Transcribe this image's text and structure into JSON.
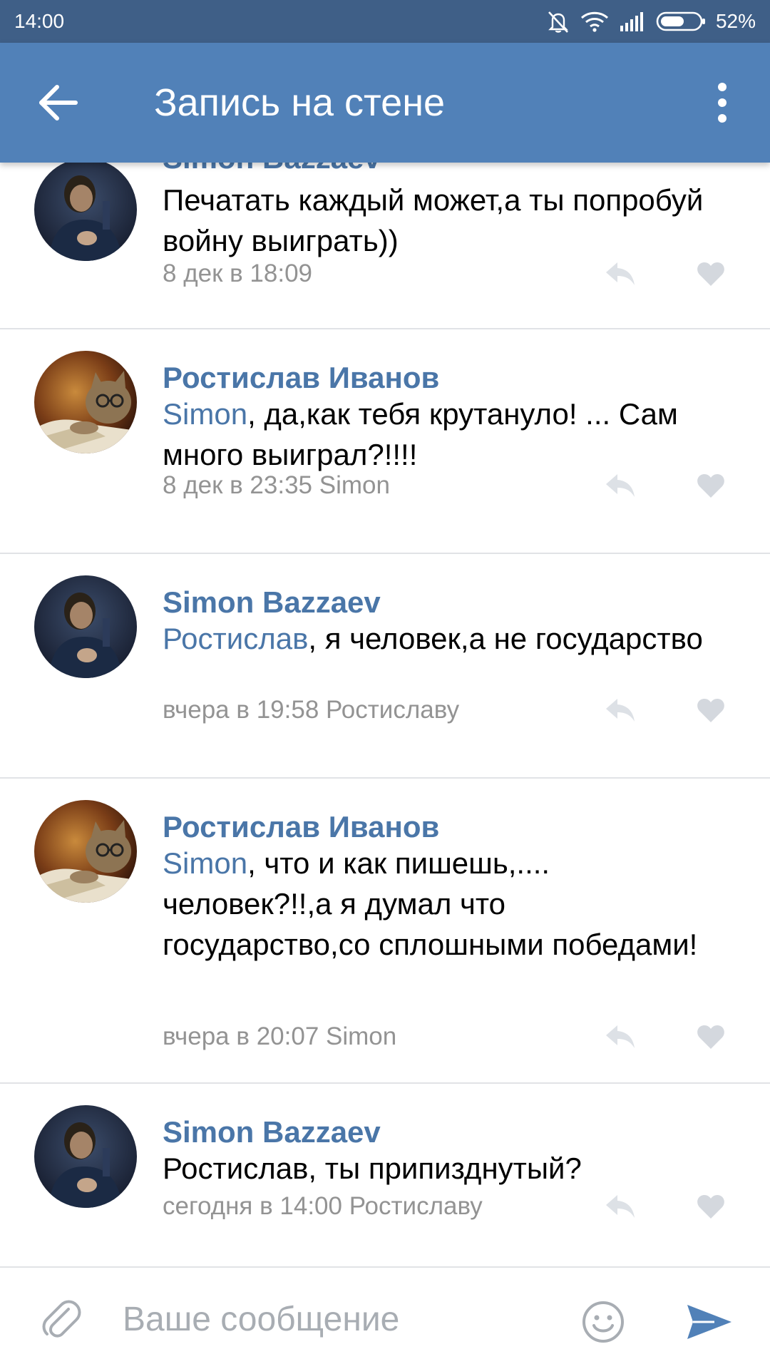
{
  "status_bar": {
    "time": "14:00",
    "battery_percent": "52%",
    "icons": [
      "muted-bell-icon",
      "wifi-icon",
      "signal-icon",
      "battery-icon"
    ]
  },
  "app_bar": {
    "title": "Запись на стене",
    "back_icon": "arrow-left-icon",
    "menu_icon": "more-vertical-icon"
  },
  "colors": {
    "status_bar": "#3f5f87",
    "app_bar": "#5181b8",
    "link": "#4a76a8",
    "meta": "#939393",
    "divider": "#e1e3e6"
  },
  "comments": [
    {
      "author": "Simon Bazzaev",
      "mention": "",
      "text": "Печатать каждый может,а ты попробуй войну выиграть))",
      "meta": "8 дек в 18:09"
    },
    {
      "author": "Ростислав Иванов",
      "mention": "Simon",
      "text": ", да,как тебя крутануло! ... Сам много выиграл?!!!!",
      "meta": "8 дек в 23:35 Simon"
    },
    {
      "author": "Simon Bazzaev",
      "mention": "Ростислав",
      "text": ", я человек,а не государство",
      "meta": "вчера в 19:58 Ростиславу"
    },
    {
      "author": "Ростислав Иванов",
      "mention": "Simon",
      "text": ", что и как пишешь,.... человек?!!,а я думал что государство,со сплошными победами!",
      "meta": "вчера в 20:07 Simon"
    },
    {
      "author": "Simon Bazzaev",
      "mention": "",
      "text": "Ростислав, ты припизднутый?",
      "meta": "сегодня в 14:00 Ростиславу"
    }
  ],
  "composer": {
    "placeholder": "Ваше сообщение",
    "value": "",
    "attach_icon": "paperclip-icon",
    "emoji_icon": "smiley-icon",
    "send_icon": "send-icon"
  }
}
